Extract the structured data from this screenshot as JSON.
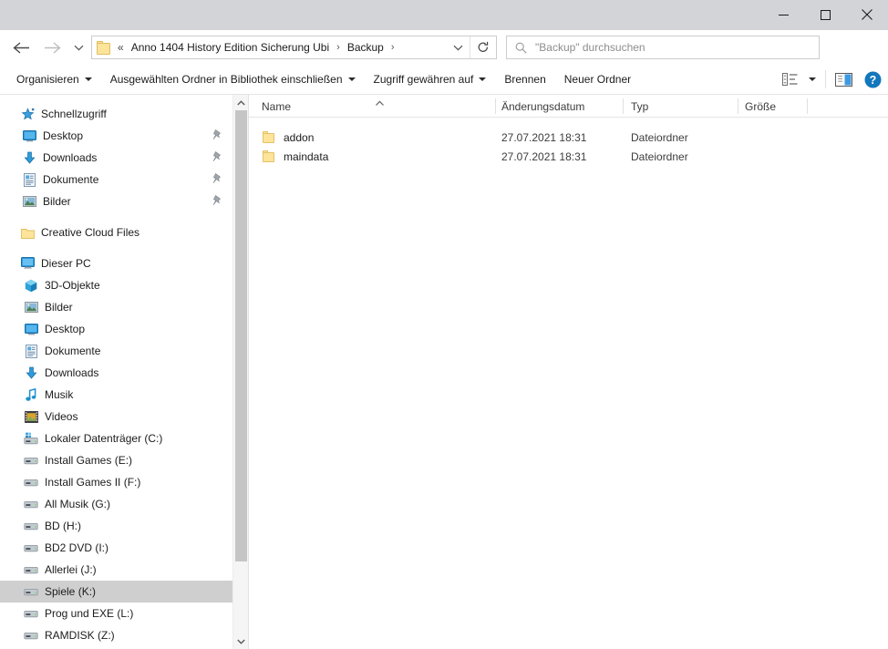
{
  "window": {
    "minimize_label": "Minimieren",
    "maximize_label": "Maximieren",
    "close_label": "Schließen"
  },
  "nav": {
    "back_label": "Zurück",
    "forward_label": "Vorwärts",
    "recent_label": "Zuletzt besuchte Orte",
    "refresh_label": "Aktualisieren",
    "dropdown_label": "Vorherige Orte",
    "breadcrumb_prefix": "«",
    "breadcrumbs": [
      {
        "label": "Anno 1404 History Edition Sicherung Ubi"
      },
      {
        "label": "Backup"
      }
    ],
    "separator": "›"
  },
  "search": {
    "placeholder": "\"Backup\" durchsuchen",
    "value": ""
  },
  "toolbar": {
    "items": [
      {
        "label": "Organisieren",
        "has_caret": true
      },
      {
        "label": "Ausgewählten Ordner in Bibliothek einschließen",
        "has_caret": true
      },
      {
        "label": "Zugriff gewähren auf",
        "has_caret": true
      },
      {
        "label": "Brennen",
        "has_caret": false
      },
      {
        "label": "Neuer Ordner",
        "has_caret": false
      }
    ],
    "view_label": "Ansicht ändern",
    "preview_label": "Vorschaufenster",
    "help_label": "Hilfe"
  },
  "sidebar": {
    "groups": [
      {
        "header": {
          "label": "Schnellzugriff",
          "icon": "star-icon"
        },
        "items": [
          {
            "label": "Desktop",
            "icon": "desktop-icon",
            "pinned": true
          },
          {
            "label": "Downloads",
            "icon": "download-icon",
            "pinned": true
          },
          {
            "label": "Dokumente",
            "icon": "document-icon",
            "pinned": true
          },
          {
            "label": "Bilder",
            "icon": "pictures-icon",
            "pinned": true
          }
        ]
      },
      {
        "header": {
          "label": "Creative Cloud Files",
          "icon": "folder-icon"
        },
        "items": []
      },
      {
        "header": {
          "label": "Dieser PC",
          "icon": "pc-icon"
        },
        "items": [
          {
            "label": "3D-Objekte",
            "icon": "cube-icon"
          },
          {
            "label": "Bilder",
            "icon": "pictures-icon"
          },
          {
            "label": "Desktop",
            "icon": "desktop-icon"
          },
          {
            "label": "Dokumente",
            "icon": "document-icon"
          },
          {
            "label": "Downloads",
            "icon": "download-icon"
          },
          {
            "label": "Musik",
            "icon": "music-icon"
          },
          {
            "label": "Videos",
            "icon": "video-icon"
          },
          {
            "label": "Lokaler Datenträger (C:)",
            "icon": "system-drive-icon"
          },
          {
            "label": "Install Games (E:)",
            "icon": "drive-icon"
          },
          {
            "label": "Install Games II (F:)",
            "icon": "drive-icon"
          },
          {
            "label": "All Musik (G:)",
            "icon": "drive-icon"
          },
          {
            "label": "BD (H:)",
            "icon": "drive-icon"
          },
          {
            "label": "BD2 DVD (I:)",
            "icon": "drive-icon"
          },
          {
            "label": "Allerlei (J:)",
            "icon": "drive-icon"
          },
          {
            "label": "Spiele (K:)",
            "icon": "drive-icon",
            "selected": true
          },
          {
            "label": "Prog und EXE (L:)",
            "icon": "drive-icon"
          },
          {
            "label": "RAMDISK (Z:)",
            "icon": "drive-icon"
          }
        ]
      }
    ]
  },
  "filelist": {
    "sort_column": "Name",
    "sort_direction": "ascending",
    "columns": [
      {
        "label": "Name"
      },
      {
        "label": "Änderungsdatum"
      },
      {
        "label": "Typ"
      },
      {
        "label": "Größe"
      }
    ],
    "rows": [
      {
        "name": "addon",
        "date": "27.07.2021 18:31",
        "type": "Dateiordner",
        "size": "",
        "icon": "folder-icon"
      },
      {
        "name": "maindata",
        "date": "27.07.2021 18:31",
        "type": "Dateiordner",
        "size": "",
        "icon": "folder-icon"
      }
    ]
  },
  "colors": {
    "titlebar": "#d3d4d8",
    "selection": "#cfcfcf",
    "folder_yellow": "#fde49a",
    "accent_blue": "#0078d7",
    "scrollbar_thumb": "#c5c5c5"
  }
}
